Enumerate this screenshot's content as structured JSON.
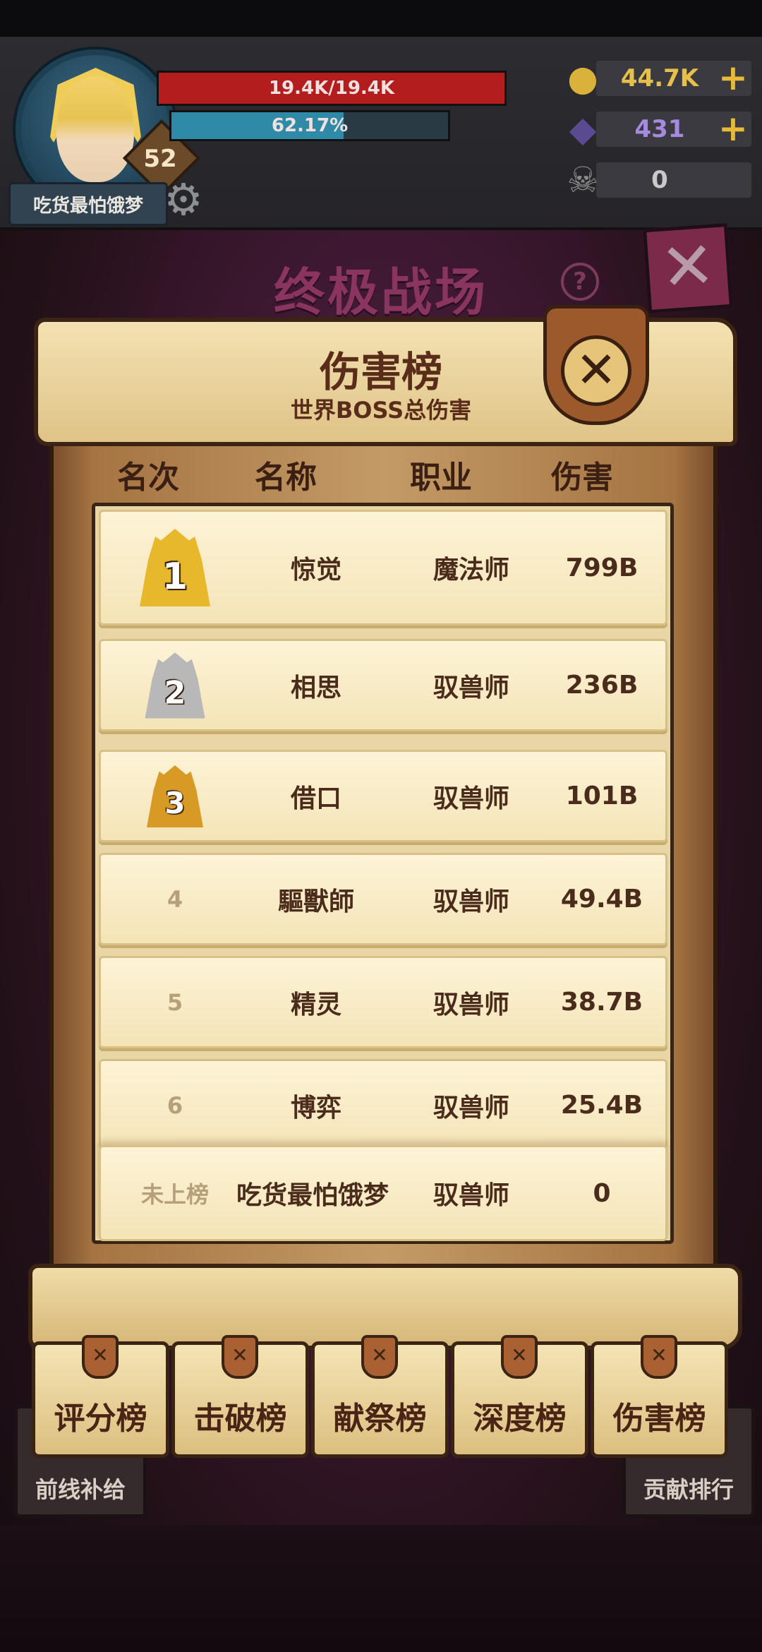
{
  "hud": {
    "level": "52",
    "player_name": "吃货最怕饿梦",
    "hp_text": "19.4K/19.4K",
    "hp_fraction": 1.0,
    "xp_text": "62.17%",
    "xp_fraction": 0.6217,
    "resources": [
      {
        "icon": "gold-coin-icon",
        "value": "44.7K",
        "color": "#e6c04a",
        "plus": "+"
      },
      {
        "icon": "crystal-icon",
        "value": "431",
        "color": "#a58ae0",
        "plus": "+"
      },
      {
        "icon": "ram-skull-icon",
        "value": "0",
        "color": "#c9c9c9",
        "plus": ""
      }
    ]
  },
  "page": {
    "title": "终极战场",
    "help": "?",
    "close": "✕"
  },
  "panel": {
    "title": "伤害榜",
    "subtitle": "世界BOSS总伤害",
    "close": "✕",
    "headers": {
      "rank": "名次",
      "name": "名称",
      "class": "职业",
      "damage": "伤害"
    },
    "rows": [
      {
        "rank": "1",
        "name": "惊觉",
        "class": "魔法师",
        "damage": "799B"
      },
      {
        "rank": "2",
        "name": "相思",
        "class": "驭兽师",
        "damage": "236B"
      },
      {
        "rank": "3",
        "name": "借口",
        "class": "驭兽师",
        "damage": "101B"
      },
      {
        "rank": "4",
        "name": "驅獸師",
        "class": "驭兽师",
        "damage": "49.4B"
      },
      {
        "rank": "5",
        "name": "精灵",
        "class": "驭兽师",
        "damage": "38.7B"
      },
      {
        "rank": "6",
        "name": "博弈",
        "class": "驭兽师",
        "damage": "25.4B"
      }
    ],
    "self_row": {
      "rank": "未上榜",
      "name": "吃货最怕饿梦",
      "class": "驭兽师",
      "damage": "0"
    }
  },
  "tabs": [
    {
      "label": "评分榜",
      "pin": "✕"
    },
    {
      "label": "击破榜",
      "pin": "✕"
    },
    {
      "label": "献祭榜",
      "pin": "✕"
    },
    {
      "label": "深度榜",
      "pin": "✕"
    },
    {
      "label": "伤害榜",
      "pin": "✕"
    }
  ],
  "side_buttons": {
    "left": "前线补给",
    "right": "贡献排行"
  }
}
